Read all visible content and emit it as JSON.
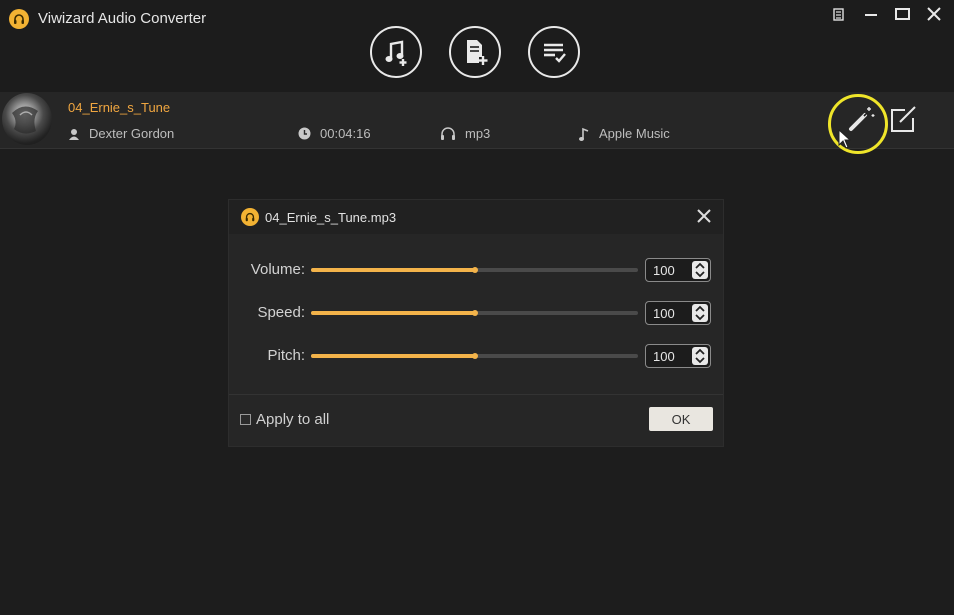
{
  "app": {
    "title": "Viwizard Audio Converter"
  },
  "window_controls": [
    "menu-icon",
    "minimize-icon",
    "maximize-icon",
    "close-icon"
  ],
  "toolbar": {
    "buttons": [
      "add-music-icon",
      "add-file-icon",
      "converted-list-icon"
    ]
  },
  "track": {
    "title": "04_Ernie_s_Tune",
    "artist": "Dexter Gordon",
    "duration": "00:04:16",
    "format": "mp3",
    "source": "Apple Music"
  },
  "dialog": {
    "title": "04_Ernie_s_Tune.mp3",
    "sliders": [
      {
        "label": "Volume:",
        "value": "100",
        "level": 0.5
      },
      {
        "label": "Speed:",
        "value": "100",
        "level": 0.5
      },
      {
        "label": "Pitch:",
        "value": "100",
        "level": 0.5
      }
    ],
    "apply_all_label": "Apply to all",
    "ok_label": "OK"
  },
  "colors": {
    "accent": "#f3b34a",
    "track_title": "#f0a640",
    "highlight": "#efe52a",
    "background": "#1d1d1d"
  }
}
